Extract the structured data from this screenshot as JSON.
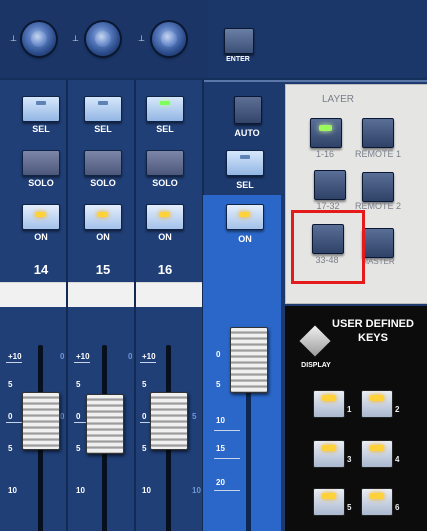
{
  "top": {
    "enter_label": "ENTER",
    "knob_marks": [
      "⊥",
      "⊥",
      "⊥"
    ]
  },
  "channels": [
    {
      "sel_label": "SEL",
      "sel_led_on": false,
      "solo_label": "SOLO",
      "on_label": "ON",
      "number": "14"
    },
    {
      "sel_label": "SEL",
      "sel_led_on": false,
      "solo_label": "SOLO",
      "on_label": "ON",
      "number": "15"
    },
    {
      "sel_label": "SEL",
      "sel_led_on": true,
      "solo_label": "SOLO",
      "on_label": "ON",
      "number": "16"
    }
  ],
  "master": {
    "auto_label": "AUTO",
    "sel_label": "SEL",
    "on_label": "ON"
  },
  "fader_scale": {
    "left": [
      "+10",
      "5",
      "0",
      "5",
      "10"
    ],
    "right_blue": [
      "0",
      "0",
      "0",
      "5",
      "10"
    ],
    "master": [
      "0",
      "5",
      "10",
      "15",
      "20"
    ]
  },
  "layer": {
    "title": "LAYER",
    "buttons": [
      {
        "label": "1-16",
        "led_on": true
      },
      {
        "label": "REMOTE 1",
        "led_on": false
      },
      {
        "label": "17-32",
        "led_on": false
      },
      {
        "label": "REMOTE 2",
        "led_on": false
      },
      {
        "label": "33-48",
        "led_on": false
      },
      {
        "label": "MASTER",
        "led_on": false
      }
    ]
  },
  "user_defined_keys": {
    "title_line1": "USER DEFINED",
    "title_line2": "KEYS",
    "display_label": "DISPLAY",
    "keys": [
      "1",
      "2",
      "3",
      "4",
      "5",
      "6"
    ]
  },
  "colors": {
    "panel": "#1d3a6f",
    "master_strip": "#2b67c9",
    "highlight": "#e51b1b",
    "led_green": "#7dff5a",
    "led_amber": "#ffd23a"
  }
}
